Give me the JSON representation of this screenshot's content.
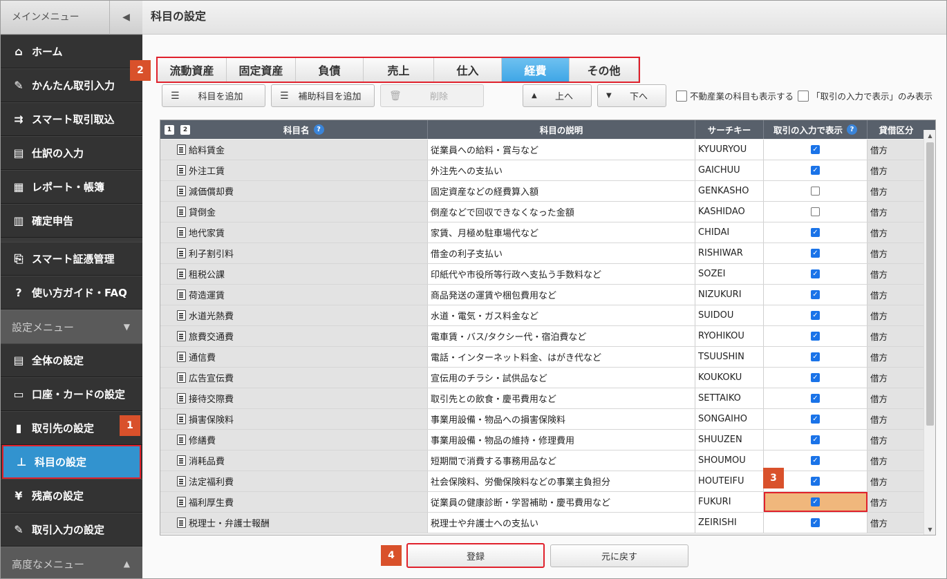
{
  "sidebar": {
    "header": "メインメニュー",
    "collapse_icon": "chevron-left-icon",
    "main_items": [
      {
        "label": "ホーム",
        "icon": "⌂"
      },
      {
        "label": "かんたん取引入力",
        "icon": "✎"
      },
      {
        "label": "スマート取引取込",
        "icon": "⇉"
      },
      {
        "label": "仕訳の入力",
        "icon": "▤"
      },
      {
        "label": "レポート・帳簿",
        "icon": "▦"
      },
      {
        "label": "確定申告",
        "icon": "▥"
      },
      {
        "label": "スマート証憑管理",
        "icon": "⎘"
      },
      {
        "label": "使い方ガイド・FAQ",
        "icon": "?"
      }
    ],
    "settings_header": "設定メニュー",
    "settings_items": [
      {
        "label": "全体の設定",
        "icon": "▤"
      },
      {
        "label": "口座・カードの設定",
        "icon": "▭"
      },
      {
        "label": "取引先の設定",
        "icon": "▮"
      },
      {
        "label": "科目の設定",
        "icon": "⊥"
      },
      {
        "label": "残高の設定",
        "icon": "¥"
      },
      {
        "label": "取引入力の設定",
        "icon": "✎"
      }
    ],
    "advanced_header": "高度なメニュー"
  },
  "badges": {
    "b1": "1",
    "b2": "2",
    "b3": "3",
    "b4": "4"
  },
  "page": {
    "title": "科目の設定"
  },
  "tabs": [
    "流動資産",
    "固定資産",
    "負債",
    "売上",
    "仕入",
    "経費",
    "その他"
  ],
  "active_tab": "経費",
  "toolbar": {
    "add_account": "科目を追加",
    "add_sub_account": "補助科目を追加",
    "delete": "削除",
    "up": "上へ",
    "down": "下へ",
    "show_real_estate": "不動産業の科目も表示する",
    "show_only_input": "「取引の入力で表示」のみ表示"
  },
  "table": {
    "headers": {
      "name": "科目名",
      "desc": "科目の説明",
      "key": "サーチキー",
      "show": "取引の入力で表示",
      "dc": "貸借区分"
    },
    "page_buttons": [
      "1",
      "2"
    ],
    "rows": [
      {
        "name": "給料賃金",
        "desc": "従業員への給料・賞与など",
        "key": "KYUURYOU",
        "show": true,
        "dc": "借方"
      },
      {
        "name": "外注工賃",
        "desc": "外注先への支払い",
        "key": "GAICHUU",
        "show": true,
        "dc": "借方"
      },
      {
        "name": "減価償却費",
        "desc": "固定資産などの経費算入額",
        "key": "GENKASHO",
        "show": false,
        "dc": "借方"
      },
      {
        "name": "貸倒金",
        "desc": "倒産などで回収できなくなった金額",
        "key": "KASHIDAO",
        "show": false,
        "dc": "借方"
      },
      {
        "name": "地代家賃",
        "desc": "家賃、月極め駐車場代など",
        "key": "CHIDAI",
        "show": true,
        "dc": "借方"
      },
      {
        "name": "利子割引料",
        "desc": "借金の利子支払い",
        "key": "RISHIWAR",
        "show": true,
        "dc": "借方"
      },
      {
        "name": "租税公課",
        "desc": "印紙代や市役所等行政へ支払う手数料など",
        "key": "SOZEI",
        "show": true,
        "dc": "借方"
      },
      {
        "name": "荷造運賃",
        "desc": "商品発送の運賃や梱包費用など",
        "key": "NIZUKURI",
        "show": true,
        "dc": "借方"
      },
      {
        "name": "水道光熱費",
        "desc": "水道・電気・ガス料金など",
        "key": "SUIDOU",
        "show": true,
        "dc": "借方"
      },
      {
        "name": "旅費交通費",
        "desc": "電車賃・バス/タクシー代・宿泊費など",
        "key": "RYOHIKOU",
        "show": true,
        "dc": "借方"
      },
      {
        "name": "通信費",
        "desc": "電話・インターネット料金、はがき代など",
        "key": "TSUUSHIN",
        "show": true,
        "dc": "借方"
      },
      {
        "name": "広告宣伝費",
        "desc": "宣伝用のチラシ・試供品など",
        "key": "KOUKOKU",
        "show": true,
        "dc": "借方"
      },
      {
        "name": "接待交際費",
        "desc": "取引先との飲食・慶弔費用など",
        "key": "SETTAIKO",
        "show": true,
        "dc": "借方"
      },
      {
        "name": "損害保険料",
        "desc": "事業用設備・物品への損害保険料",
        "key": "SONGAIHO",
        "show": true,
        "dc": "借方"
      },
      {
        "name": "修繕費",
        "desc": "事業用設備・物品の維持・修理費用",
        "key": "SHUUZEN",
        "show": true,
        "dc": "借方"
      },
      {
        "name": "消耗品費",
        "desc": "短期間で消費する事務用品など",
        "key": "SHOUMOU",
        "show": true,
        "dc": "借方"
      },
      {
        "name": "法定福利費",
        "desc": "社会保険料、労働保険料などの事業主負担分",
        "key": "HOUTEIFU",
        "show": true,
        "dc": "借方"
      },
      {
        "name": "福利厚生費",
        "desc": "従業員の健康診断・学習補助・慶弔費用など",
        "key": "FUKURI",
        "show": true,
        "dc": "借方"
      },
      {
        "name": "税理士・弁護士報酬",
        "desc": "税理士や弁護士への支払い",
        "key": "ZEIRISHI",
        "show": true,
        "dc": "借方"
      }
    ]
  },
  "footer": {
    "register": "登録",
    "revert": "元に戻す"
  }
}
